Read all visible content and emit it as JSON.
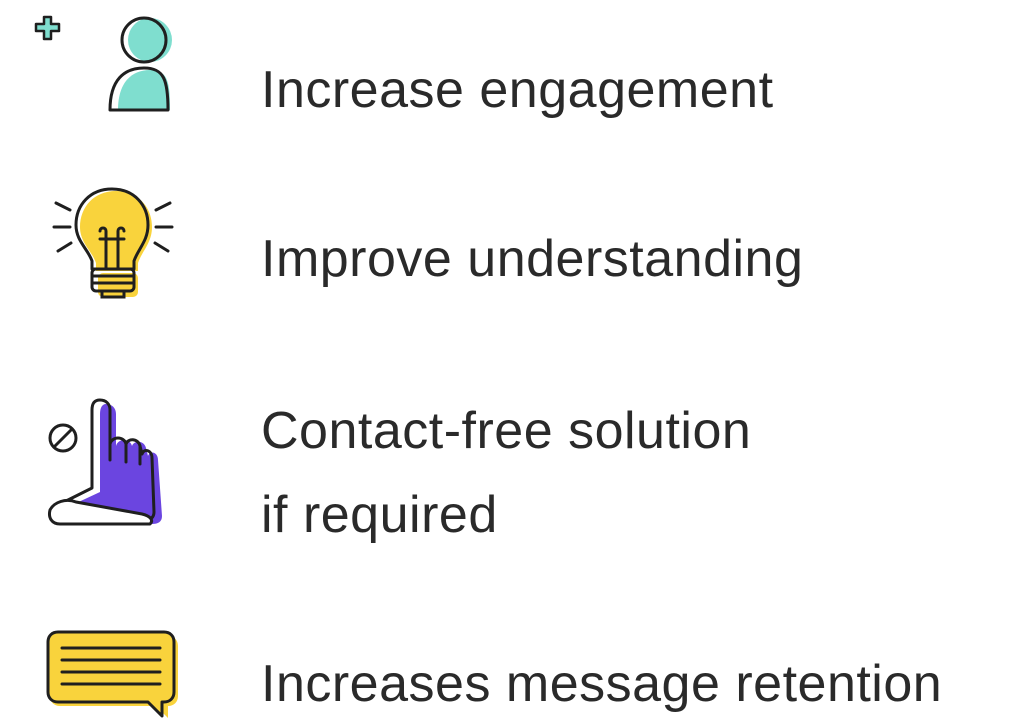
{
  "colors": {
    "text": "#2a2a2a",
    "teal": "#7fdecf",
    "yellow": "#f9d33c",
    "purple": "#6b45e0",
    "outline": "#1f1f1f"
  },
  "features": [
    {
      "icon": "add-user-icon",
      "text": "Increase engagement"
    },
    {
      "icon": "lightbulb-icon",
      "text": "Improve understanding"
    },
    {
      "icon": "touch-free-hand-icon",
      "line1": "Contact-free solution",
      "line2": "if required"
    },
    {
      "icon": "chat-bubble-icon",
      "text": "Increases message retention"
    }
  ]
}
